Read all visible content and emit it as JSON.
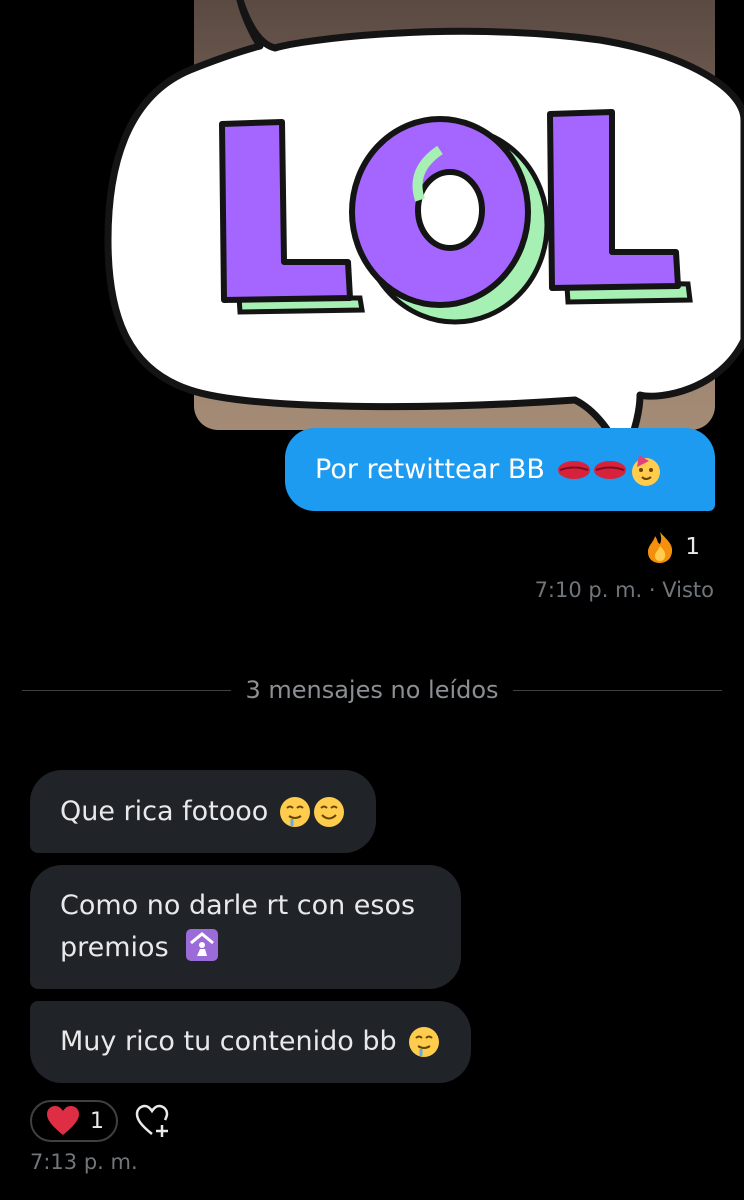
{
  "sent": {
    "text": "Por retwittear BB",
    "emoji_icons": [
      "kiss-mark-icon",
      "kiss-mark-icon",
      "partying-face-icon"
    ],
    "reaction": {
      "icon": "fire-icon",
      "count": "1"
    },
    "meta": "7:10 p. m. · Visto"
  },
  "sticker": {
    "text": "LOL",
    "colors": {
      "fill": "#a566ff",
      "side": "#a6f0b4",
      "outline": "#141414"
    }
  },
  "divider": {
    "label": "3 mensajes no leídos"
  },
  "received": [
    {
      "text": "Que rica fotooo",
      "emoji_icons": [
        "drooling-face-icon",
        "smiling-face-icon"
      ]
    },
    {
      "text": "Como no darle rt con esos premios",
      "emoji_icons": [
        "place-of-worship-icon"
      ]
    },
    {
      "text": "Muy rico tu contenido bb",
      "emoji_icons": [
        "drooling-face-icon"
      ]
    }
  ],
  "received_reaction": {
    "icon": "heart-icon",
    "count": "1"
  },
  "received_meta": "7:13 p. m.",
  "colors": {
    "sent_bubble": "#1d9bf0",
    "received_bubble": "#202327",
    "background": "#000000",
    "muted_text": "#71767b"
  }
}
